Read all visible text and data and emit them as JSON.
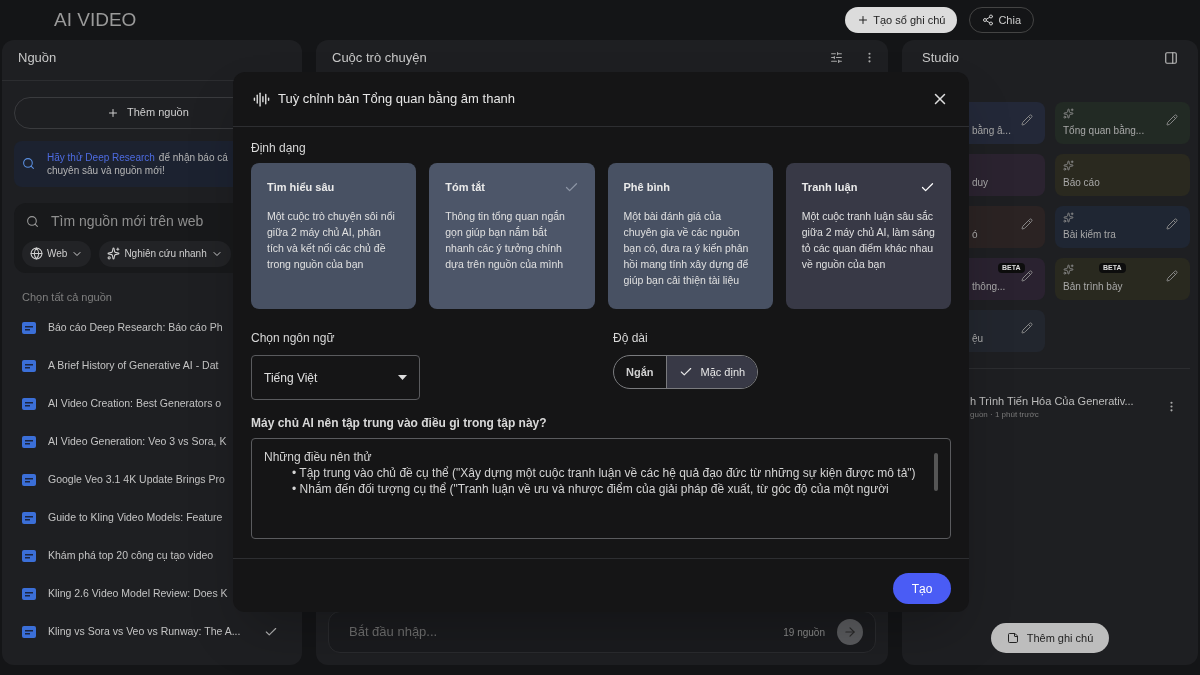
{
  "header": {
    "notebook_title": "AI VIDEO",
    "create_button": "Tạo sổ ghi chú",
    "share_button": "Chia"
  },
  "sources": {
    "title": "Nguồn",
    "add_button": "Thêm nguồn",
    "banner": {
      "link": "Hãy thử Deep Research",
      "text": "để nhận báo cá",
      "text_line2": "chuyên sâu và nguồn mới!"
    },
    "search": {
      "placeholder": "Tìm nguồn mới trên web",
      "chips": [
        "Web",
        "Nghiên cứu nhanh"
      ]
    },
    "select_all": "Chọn tất cả nguồn",
    "items": [
      {
        "title": "Báo cáo Deep Research: Báo cáo Ph",
        "checked": false
      },
      {
        "title": "A Brief History of Generative AI - Dat",
        "checked": false
      },
      {
        "title": "AI Video Creation: Best Generators o",
        "checked": false
      },
      {
        "title": "AI Video Generation: Veo 3 vs Sora, K",
        "checked": false
      },
      {
        "title": "Google Veo 3.1 4K Update Brings Pro",
        "checked": false
      },
      {
        "title": "Guide to Kling Video Models: Feature",
        "checked": false
      },
      {
        "title": "Khám phá top 20 công cụ tạo video",
        "checked": false
      },
      {
        "title": "Kling 2.6 Video Model Review: Does K",
        "checked": false
      },
      {
        "title": "Kling vs Sora vs Veo vs Runway: The A...",
        "checked": true
      }
    ]
  },
  "chat": {
    "title": "Cuộc trò chuyện",
    "input": {
      "placeholder": "Bắt đầu nhập..."
    },
    "source_count": "19 nguồn"
  },
  "studio": {
    "title": "Studio",
    "tiles": [
      {
        "label": "bằng â...",
        "color": "#232838",
        "editable": true,
        "partial": true
      },
      {
        "label": "Tổng quan bằng...",
        "color": "#222a24",
        "editable": true,
        "partial": false
      },
      {
        "label": "duy",
        "color": "#2b2330",
        "editable": false,
        "partial": true
      },
      {
        "label": "Báo cáo",
        "color": "#2a291f",
        "editable": false,
        "partial": false
      },
      {
        "label": "ó",
        "color": "#2b2323",
        "editable": true,
        "partial": true
      },
      {
        "label": "Bài kiểm tra",
        "color": "#1f2633",
        "editable": true,
        "partial": false
      },
      {
        "label": "thông...",
        "color": "#2a2230",
        "editable": true,
        "beta_label": "BETA",
        "partial": true
      },
      {
        "label": "Bản trình bày",
        "color": "#29291f",
        "editable": true,
        "beta_label": "BETA",
        "partial": false
      },
      {
        "label": "ệu",
        "color": "#22262e",
        "editable": true,
        "partial": true
      }
    ],
    "note": {
      "title": "h Trình Tiến Hóa Của Generativ...",
      "meta": "guồn · 1 phút trước"
    },
    "add_note_button": "Thêm ghi chú"
  },
  "dialog": {
    "title": "Tuỳ chỉnh bản Tổng quan bằng âm thanh",
    "format_label": "Định dạng",
    "formats": [
      {
        "title": "Tìm hiểu sâu",
        "description": "Một cuộc trò chuyện sôi nổi giữa 2 máy chủ AI, phân tích và kết nối các chủ đề trong nguồn của bạn",
        "selected": false,
        "hovered": false
      },
      {
        "title": "Tóm tắt",
        "description": "Thông tin tổng quan ngắn gọn giúp bạn nắm bắt nhanh các ý tưởng chính dựa trên nguồn của mình",
        "selected": false,
        "hovered": true
      },
      {
        "title": "Phê bình",
        "description": "Một bài đánh giá của chuyên gia về các nguồn bạn có, đưa ra ý kiến phản hồi mang tính xây dựng để giúp bạn cải thiện tài liệu",
        "selected": false,
        "hovered": false
      },
      {
        "title": "Tranh luận",
        "description": "Một cuộc tranh luận sâu sắc giữa 2 máy chủ AI, làm sáng tỏ các quan điểm khác nhau về nguồn của bạn",
        "selected": true,
        "hovered": false
      }
    ],
    "language_label": "Chọn ngôn ngữ",
    "language_value": "Tiếng Việt",
    "length_label": "Độ dài",
    "lengths": [
      {
        "label": "Ngắn",
        "selected": false
      },
      {
        "label": "Mặc định",
        "selected": true
      }
    ],
    "focus_label": "Máy chủ AI nên tập trung vào điều gì trong tập này?",
    "focus_hint": {
      "heading": "Những điều nên thử",
      "items": [
        "• Tập trung vào chủ đề cụ thể (\"Xây dựng một cuộc tranh luận về các hệ quả đạo đức từ những sự kiện được mô tả\")",
        "• Nhắm đến đối tượng cụ thể (\"Tranh luận về ưu và nhược điểm của giải pháp đề xuất, từ góc độ của một người"
      ]
    },
    "submit_button": "Tạo"
  }
}
